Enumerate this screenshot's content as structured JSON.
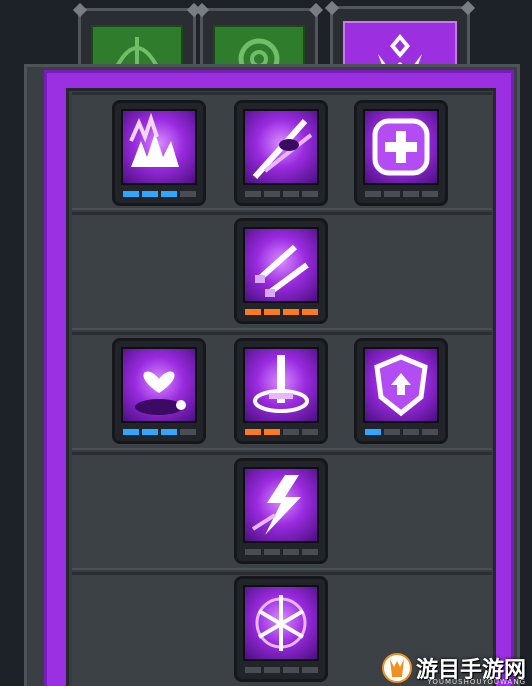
{
  "tabs": [
    {
      "name": "bow",
      "icon": "bow-icon",
      "color": "#2f7d2c"
    },
    {
      "name": "swirl",
      "icon": "swirl-icon",
      "color": "#2f7d2c"
    },
    {
      "name": "trident",
      "icon": "trident-emblem-icon",
      "color": "#9c2fe0",
      "active": true
    }
  ],
  "skills": [
    {
      "id": "burst-claws",
      "icon": "burst-claws-icon",
      "pips": 4,
      "level": 3,
      "pip_color": "blue"
    },
    {
      "id": "dash-strike",
      "icon": "dash-strike-icon",
      "pips": 4,
      "level": 0,
      "pip_color": "blue"
    },
    {
      "id": "heal-cross",
      "icon": "heal-cross-icon",
      "pips": 4,
      "level": 0,
      "pip_color": "blue"
    },
    {
      "id": "twin-daggers",
      "icon": "twin-daggers-icon",
      "pips": 4,
      "level": 4,
      "pip_color": "orange"
    },
    {
      "id": "pet-heart",
      "icon": "pet-heart-icon",
      "pips": 4,
      "level": 3,
      "pip_color": "blue"
    },
    {
      "id": "sword-circle",
      "icon": "sword-circle-icon",
      "pips": 4,
      "level": 2,
      "pip_color": "orange"
    },
    {
      "id": "shield-up",
      "icon": "shield-up-icon",
      "pips": 4,
      "level": 1,
      "pip_color": "blue"
    },
    {
      "id": "lightning-arrow",
      "icon": "lightning-arrow-icon",
      "pips": 4,
      "level": 0,
      "pip_color": "blue"
    },
    {
      "id": "swords-ring",
      "icon": "swords-ring-icon",
      "pips": 4,
      "level": 0,
      "pip_color": "blue"
    }
  ],
  "colors": {
    "accent": "#9b2fe2",
    "pip_blue": "#2fa6ff",
    "pip_orange": "#ff7a1f",
    "pip_off": "#4a4e54"
  },
  "watermark": {
    "title": "游目手游网",
    "sub": "YOUMUSHOUYOUWANG"
  }
}
